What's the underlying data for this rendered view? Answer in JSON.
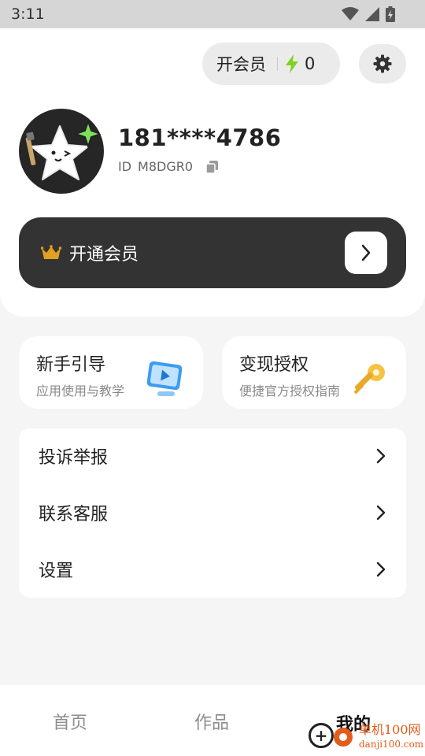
{
  "status_bar": {
    "time": "3:11"
  },
  "header": {
    "vip_pill_label": "开会员",
    "energy_count": "0"
  },
  "profile": {
    "username": "181****4786",
    "id_label": "ID",
    "id_value": "M8DGR0"
  },
  "vip_banner": {
    "label": "开通会员"
  },
  "features": [
    {
      "title": "新手引导",
      "subtitle": "应用使用与教学",
      "icon": "monitor-play-icon"
    },
    {
      "title": "变现授权",
      "subtitle": "便捷官方授权指南",
      "icon": "key-icon"
    }
  ],
  "menu": [
    {
      "label": "投诉举报"
    },
    {
      "label": "联系客服"
    },
    {
      "label": "设置"
    }
  ],
  "tabs": [
    {
      "label": "首页"
    },
    {
      "label": "作品"
    },
    {
      "label": "我的"
    }
  ],
  "watermark": {
    "brand": "单机100网",
    "url": "danji100.com"
  },
  "colors": {
    "accent_bolt": "#7ed321",
    "banner_bg": "#333333",
    "crown": "#e0a020",
    "watermark": "#e25c1a"
  }
}
